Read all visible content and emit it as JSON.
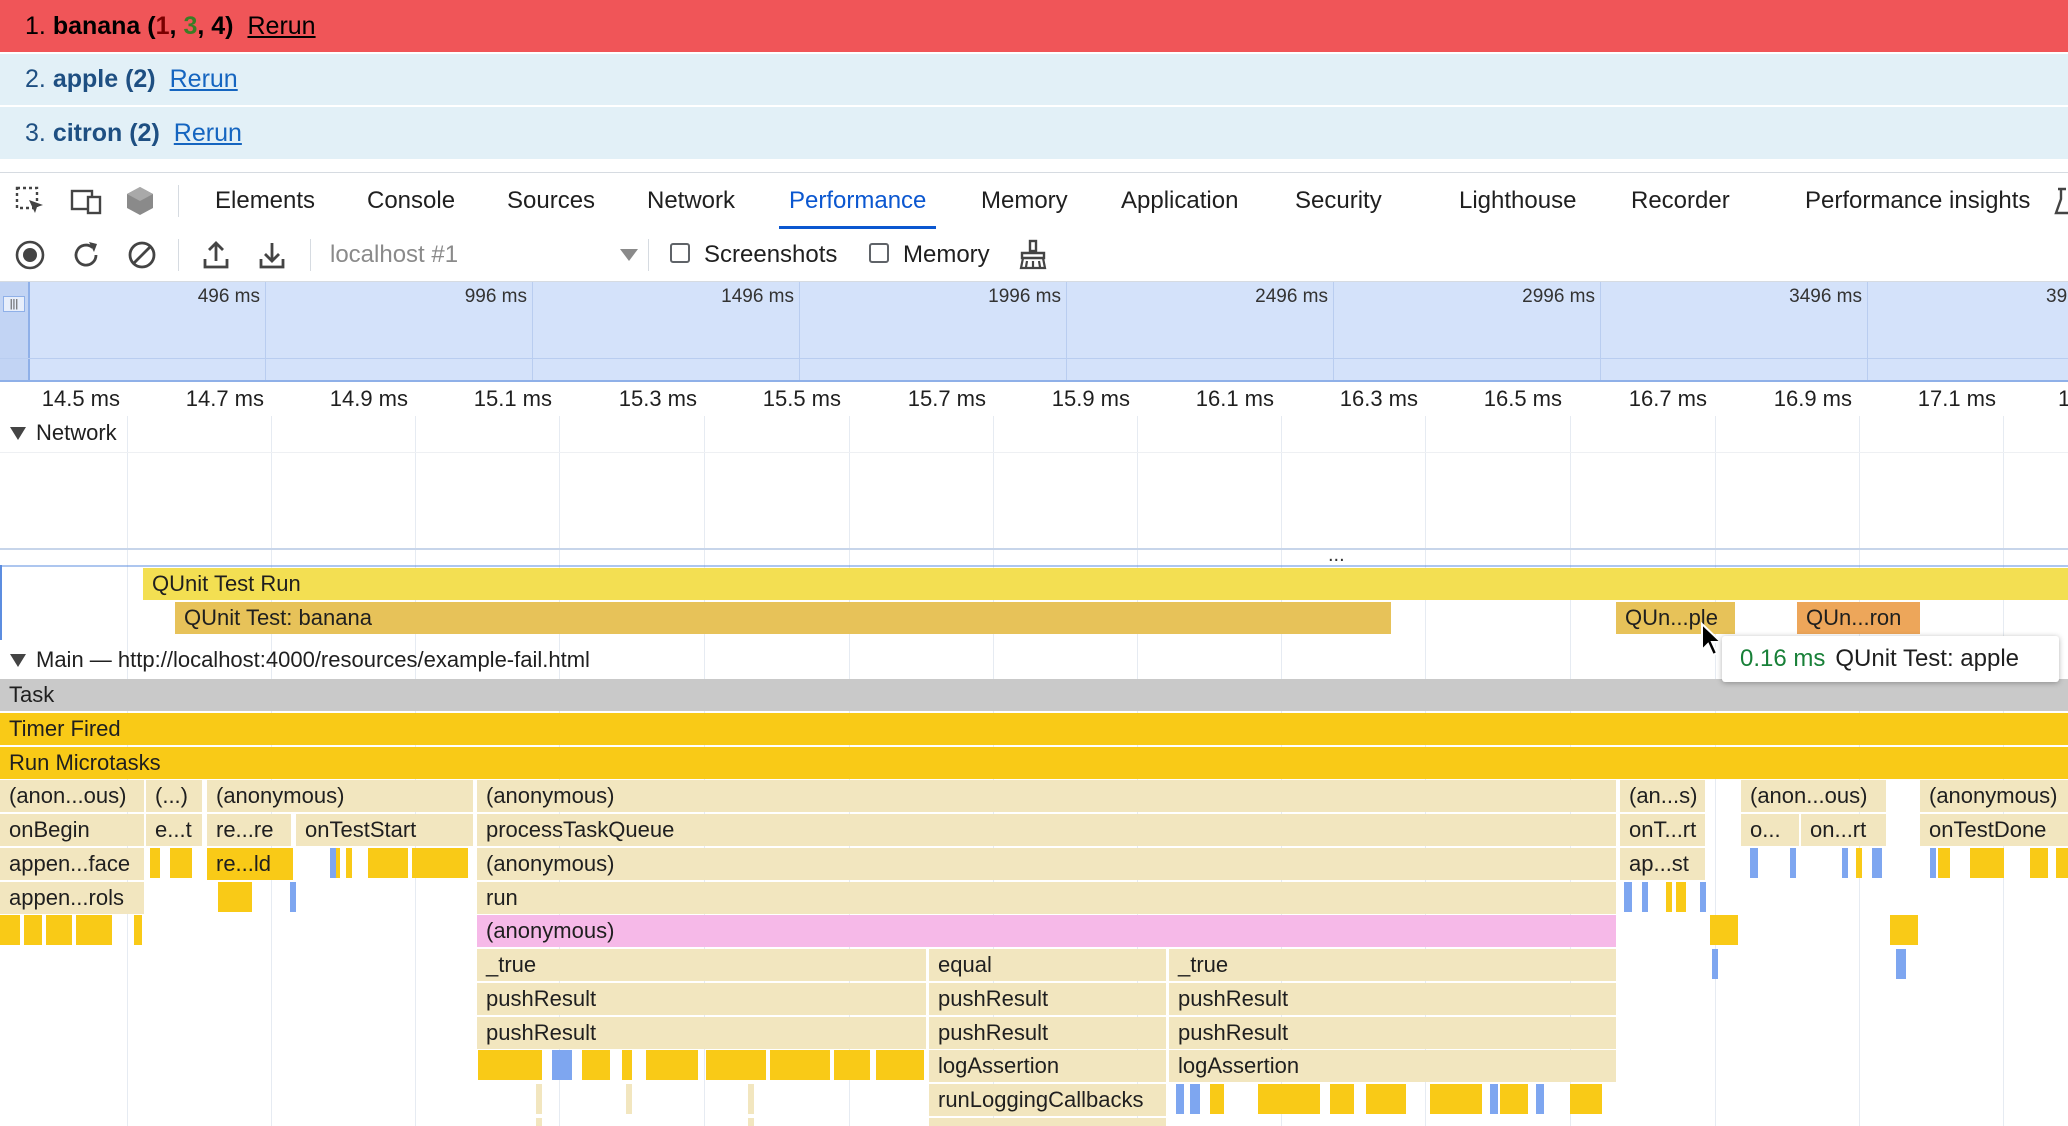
{
  "qunit": {
    "rows": [
      {
        "index": "1.",
        "name": "banana",
        "counts_open": "(",
        "c1": "1",
        "comma1": ", ",
        "c2": "3",
        "comma2": ", ",
        "c3": "4",
        "counts_close": ")",
        "rerun": "Rerun"
      },
      {
        "index": "2.",
        "name": "apple",
        "counts": "(2)",
        "rerun": "Rerun"
      },
      {
        "index": "3.",
        "name": "citron",
        "counts": "(2)",
        "rerun": "Rerun"
      }
    ]
  },
  "devtools": {
    "tabs": [
      "Elements",
      "Console",
      "Sources",
      "Network",
      "Performance",
      "Memory",
      "Application",
      "Security",
      "Lighthouse",
      "Recorder",
      "Performance insights"
    ],
    "active_tab": "Performance",
    "toolbar": {
      "target": "localhost #1",
      "screenshots_label": "Screenshots",
      "memory_label": "Memory",
      "screenshots_checked": false,
      "memory_checked": false
    }
  },
  "overview": {
    "ticks": [
      "496 ms",
      "996 ms",
      "1496 ms",
      "1996 ms",
      "2496 ms",
      "2996 ms",
      "3496 ms",
      "39"
    ]
  },
  "ruler": {
    "ticks": [
      "14.5 ms",
      "14.7 ms",
      "14.9 ms",
      "15.1 ms",
      "15.3 ms",
      "15.5 ms",
      "15.7 ms",
      "15.9 ms",
      "16.1 ms",
      "16.3 ms",
      "16.5 ms",
      "16.7 ms",
      "16.9 ms",
      "17.1 ms",
      "1"
    ]
  },
  "tracks": {
    "network_label": "Network",
    "timings": {
      "run": "QUnit Test Run",
      "banana": "QUnit Test: banana",
      "apple_short": "QUn...ple",
      "citron_short": "QUn...ron"
    },
    "main_label": "Main — http://localhost:4000/resources/example-fail.html",
    "ellipsis": "...",
    "flame": {
      "task": "Task",
      "timer": "Timer Fired",
      "microtasks": "Run Microtasks",
      "row4": [
        "(anon...ous)",
        "(...)",
        "(anonymous)",
        "(anonymous)",
        "(an...s)",
        "(anon...ous)",
        "(anonymous)"
      ],
      "row5": [
        "onBegin",
        "e...t",
        "re...re",
        "onTestStart",
        "processTaskQueue",
        "onT...rt",
        "o...",
        "on...rt",
        "onTestDone"
      ],
      "row6": [
        "appen...face",
        "re...ld",
        "(anonymous)",
        "ap...st"
      ],
      "row7": [
        "appen...rols",
        "run"
      ],
      "row8": [
        "(anonymous)"
      ],
      "row9": [
        "_true",
        "equal",
        "_true"
      ],
      "row10": [
        "pushResult",
        "pushResult",
        "pushResult"
      ],
      "row11": [
        "pushResult",
        "pushResult",
        "pushResult"
      ],
      "row12": [
        "logAssertion",
        "logAssertion"
      ],
      "row13": [
        "runLoggingCallbacks"
      ]
    }
  },
  "tooltip": {
    "duration": "0.16 ms",
    "label": "QUnit Test: apple"
  },
  "colors": {
    "fail_row": "#f05558",
    "pass_row": "#e2f0f7",
    "active_tab": "#0b57d0",
    "script_yellow": "#f9ca17",
    "light_yellow": "#f2e6bf",
    "pink": "#f6b9e8"
  }
}
